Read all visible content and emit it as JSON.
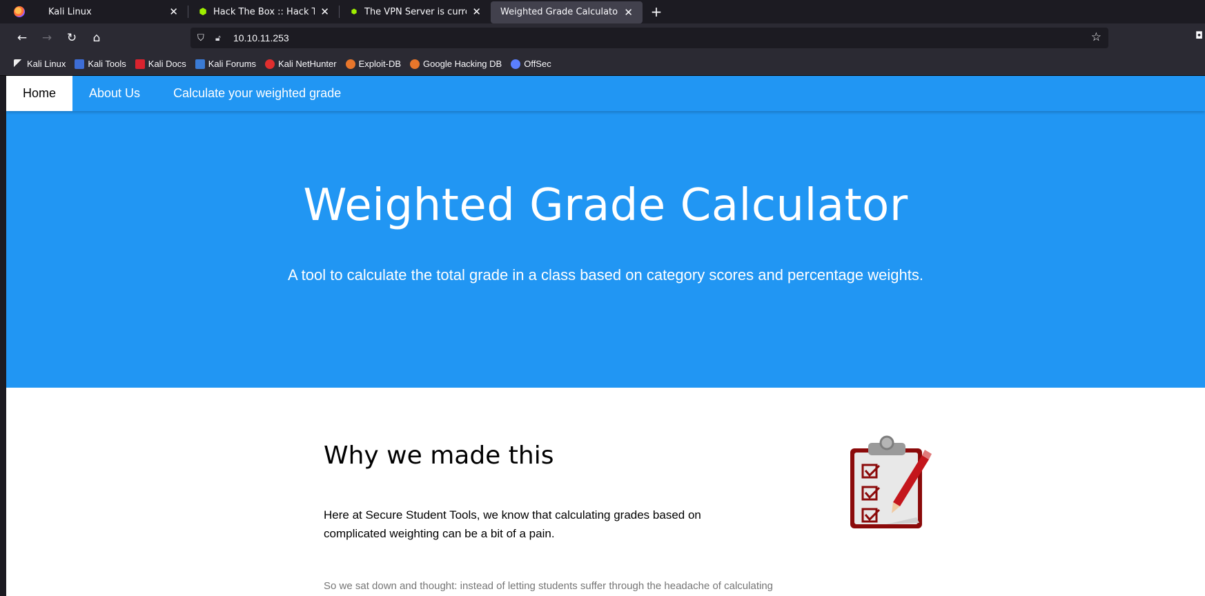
{
  "browser": {
    "tabs": [
      {
        "label": "Kali Linux",
        "icon": "kali-icon"
      },
      {
        "label": "Hack The Box :: Hack The Box",
        "icon": "htb-cube-icon"
      },
      {
        "label": "The VPN Server is currently",
        "icon": "htb-icon"
      },
      {
        "label": "Weighted Grade Calculator",
        "icon": "",
        "active": true
      }
    ],
    "url": "10.10.11.253",
    "bookmarks": [
      {
        "label": "Kali Linux",
        "color": "#ffffff"
      },
      {
        "label": "Kali Tools",
        "color": "#3d6dd6"
      },
      {
        "label": "Kali Docs",
        "color": "#d9232e"
      },
      {
        "label": "Kali Forums",
        "color": "#3a7bd5"
      },
      {
        "label": "Kali NetHunter",
        "color": "#e02e2e"
      },
      {
        "label": "Exploit-DB",
        "color": "#e8762b"
      },
      {
        "label": "Google Hacking DB",
        "color": "#e8762b"
      },
      {
        "label": "OffSec",
        "color": "#5b7fff"
      }
    ]
  },
  "site": {
    "nav": {
      "home": "Home",
      "about": "About Us",
      "calculate": "Calculate your weighted grade"
    },
    "hero": {
      "title": "Weighted Grade Calculator",
      "subtitle": "A tool to calculate the total grade in a class based on category scores and percentage weights."
    },
    "about": {
      "heading": "Why we made this",
      "lead": "Here at Secure Student Tools, we know that calculating grades based on complicated weighting can be a bit of a pain.",
      "body": "So we sat down and thought: instead of letting students suffer through the headache of calculating"
    }
  },
  "colors": {
    "primary": "#2196f3",
    "chrome_dark": "#1c1b22",
    "chrome": "#2b2a33"
  }
}
